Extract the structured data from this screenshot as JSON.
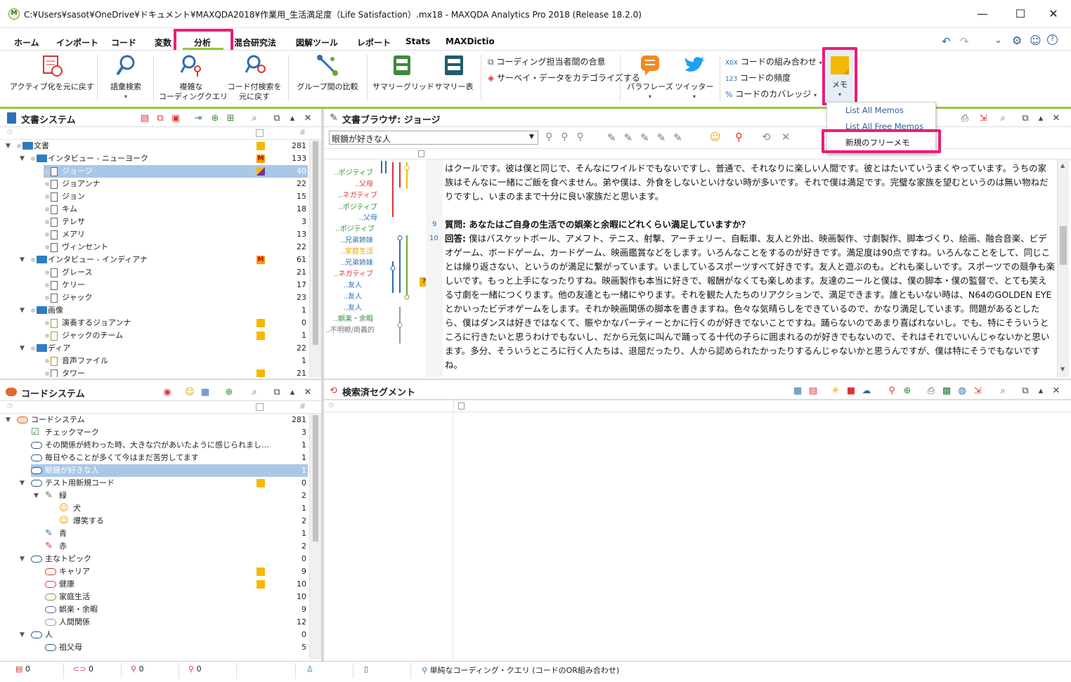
{
  "window": {
    "title": "C:¥Users¥sasot¥OneDrive¥ドキュメント¥MAXQDA2018¥作業用_生活満足度（Life Satisfaction）.mx18 - MAXQDA Analytics Pro 2018 (Release 18.2.0)",
    "app_icon": "M",
    "min": "—",
    "max": "☐",
    "close": "✕"
  },
  "menu": {
    "tabs": [
      "ホーム",
      "インポート",
      "コード",
      "変数",
      "分析",
      "混合研究法",
      "図解ツール",
      "レポート",
      "Stats",
      "MAXDictio"
    ],
    "active": "分析"
  },
  "ribbon": {
    "b1": "アクティブ化を元に戻す",
    "b2": "語彙検索",
    "b3a": "複雑な",
    "b3b": "コーディングクエリ",
    "b4a": "コード付検索を",
    "b4b": "元に戻す",
    "b5": "グループ間の比較",
    "b6": "サマリーグリッド",
    "b7": "サマリー表",
    "b8": "コーディング担当者間の合意",
    "b9": "サーベイ・データをカテゴライズする",
    "b10": "パラフレーズ",
    "b11": "ツイッター",
    "b12": "コードの組み合わせ",
    "b12p": "X0X",
    "b13": "コードの頻度",
    "b13p": "123",
    "b14": "コードのカバレッジ",
    "b14p": "%",
    "b15": "メモ"
  },
  "dropdown": {
    "items": [
      "List All Memos",
      "List All Free Memos",
      "新規のフリーメモ"
    ]
  },
  "doc_system": {
    "title": "文書システム",
    "rows": [
      {
        "label": "文書",
        "n": "281"
      },
      {
        "label": "インタビュー - ニューヨーク",
        "n": "133"
      },
      {
        "label": "ジョージ",
        "n": "40"
      },
      {
        "label": "ジョアンナ",
        "n": "22"
      },
      {
        "label": "ジョン",
        "n": "15"
      },
      {
        "label": "キム",
        "n": "18"
      },
      {
        "label": "テレサ",
        "n": "3"
      },
      {
        "label": "メアリ",
        "n": "13"
      },
      {
        "label": "ヴィンセント",
        "n": "22"
      },
      {
        "label": "インタビュー - インディアナ",
        "n": "61"
      },
      {
        "label": "グレース",
        "n": "21"
      },
      {
        "label": "ケリー",
        "n": "17"
      },
      {
        "label": "ジャック",
        "n": "23"
      },
      {
        "label": "画像",
        "n": "1"
      },
      {
        "label": "演奏するジョアンナ",
        "n": "0"
      },
      {
        "label": "ジャックのチーム",
        "n": "1"
      },
      {
        "label": "ディア",
        "n": "22"
      },
      {
        "label": "音声ファイル",
        "n": "1"
      },
      {
        "label": "タワー",
        "n": "21"
      }
    ]
  },
  "code_system": {
    "title": "コードシステム",
    "rows": [
      {
        "label": "コードシステム",
        "n": "281"
      },
      {
        "label": "チェックマーク",
        "n": "3"
      },
      {
        "label": "その関係が終わった時、大きな穴があいたように感じられましたよ…",
        "n": "1"
      },
      {
        "label": "毎日やることが多くて今はまだ苦労してます",
        "n": "1"
      },
      {
        "label": "眼鏡が好きな人",
        "n": "1"
      },
      {
        "label": "テスト用新規コード",
        "n": "0"
      },
      {
        "label": "緑",
        "n": "2"
      },
      {
        "label": "犬",
        "n": "1"
      },
      {
        "label": "爆笑する",
        "n": "2"
      },
      {
        "label": "青",
        "n": "1"
      },
      {
        "label": "赤",
        "n": "2"
      },
      {
        "label": "主なトピック",
        "n": "0"
      },
      {
        "label": "キャリア",
        "n": "9"
      },
      {
        "label": "健康",
        "n": "10"
      },
      {
        "label": "家庭生活",
        "n": "10"
      },
      {
        "label": "娯楽・余暇",
        "n": "9"
      },
      {
        "label": "人間関係",
        "n": "12"
      },
      {
        "label": "人",
        "n": "0"
      },
      {
        "label": "祖父母",
        "n": "5"
      }
    ]
  },
  "doc_browser": {
    "title": "文書ブラウザ: ジョージ",
    "combo": "眼鏡が好きな人",
    "codes": [
      "..ポジティブ",
      "..父母",
      "..ネガティブ",
      "..ポジティブ",
      "..父母",
      "..ポジティブ",
      "..兄弟姉妹",
      "..家庭生活",
      "..兄弟姉妹",
      "..ネガティブ",
      "..友人",
      "..友人",
      "..友人",
      "..娯楽・余暇",
      "..不明瞭/両義的"
    ],
    "line9": "9",
    "line10": "10",
    "p1": "はクールです。彼は僕と同じで、そんなにワイルドでもないですし、普通で、それなりに楽しい人間です。彼とはたいていうまくやっています。うちの家族はそんなに一緒にご飯を食べません。弟や僕は、外食をしないといけない時が多いです。それで僕は満足です。完璧な家族を望むというのは無い物ねだりですし、いまのままで十分に良い家族だと思います。",
    "q_label": "質問:",
    "q": "あなたはご自身の生活での娯楽と余暇にどれくらい満足していますか？",
    "a_label": "回答:",
    "a": "僕はバスケットボール、アメフト、テニス、射撃、アーチェリー、自転車、友人と外出、映画製作、寸劇製作、脚本づくり、絵画、融合音楽、ビデオゲーム、ボードゲーム、カードゲーム、映画鑑賞などをします。いろんなことをするのが好きです。満足度は90点ですね。いろんなことをして、同じことは繰り返さない、というのが満足に繋がっています。いましているスポーツすべて好きです。友人と遊ぶのも。どれも楽しいです。スポーツでの競争も楽しいです。もっと上手になったりすね。映画製作も本当に好きで、報酬がなくても楽しめます。友達のニールと僕は、僕の脚本・僕の監督で、とても笑える寸劇を一緒につくります。他の友達とも一緒にやります。それを観た人たちのリアクションで、満足できます。誰ともいない時は、N64のGOLDEN EYEとかいったビデオゲームをします。それか映画関係の脚本を書きますね。色々な気晴らしをできているので、かなり満足しています。問題があるとしたら、僕はダンスは好きではなくて、賑やかなパーティーとかに行くのが好きでないことですね。踊らないのであまり喜ばれないし。でも、特にそういうところに行きたいと思うわけでもないし、だから元気に叫んで踊ってる十代の子らに囲まれるのが好きでもないので、それはそれでいいんじゃないかと思います。多分、そういうところに行く人たちは、退屈だったり、人から認められたかったりするんじゃないかと思うんですが、僕は特にそうでもないですね。"
  },
  "retrieved": {
    "title": "検索済セグメント"
  },
  "status": {
    "c1": "0",
    "c2": "0",
    "c3": "0",
    "c4": "0",
    "query": "単純なコーディング・クエリ (コードのOR組み合わせ)"
  },
  "colors": {
    "accent_green": "#9bc53d",
    "highlight": "#ec1c76",
    "memo_yellow": "#f5b800",
    "selected": "#a9c8e8"
  }
}
